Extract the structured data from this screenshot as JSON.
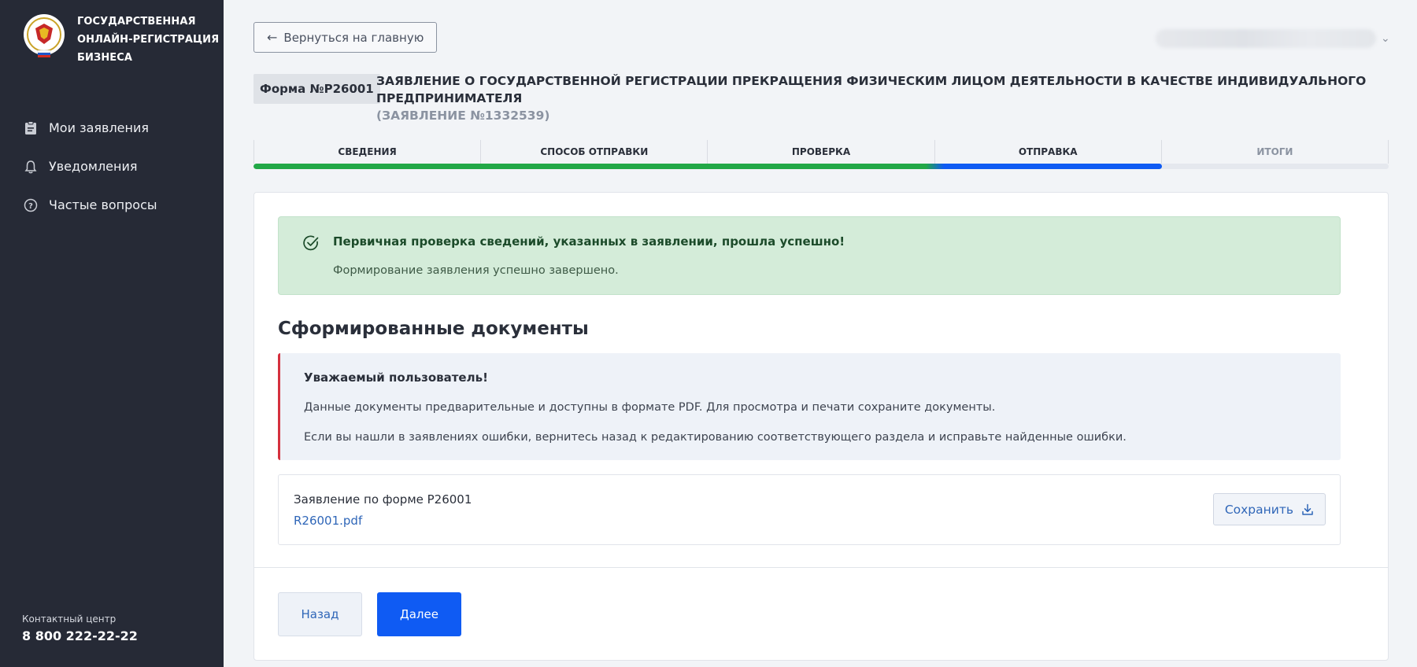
{
  "sidebar": {
    "brand": {
      "line1": "ГОСУДАРСТВЕННАЯ",
      "line2": "ОНЛАЙН-РЕГИСТРАЦИЯ",
      "line3": "БИЗНЕСА"
    },
    "nav": [
      {
        "label": "Мои заявления",
        "icon": "clipboard-icon"
      },
      {
        "label": "Уведомления",
        "icon": "bell-icon"
      },
      {
        "label": "Частые вопросы",
        "icon": "question-icon"
      }
    ],
    "contact": {
      "label": "Контактный центр",
      "phone": "8 800 222-22-22"
    }
  },
  "header": {
    "back_label": "Вернуться на главную",
    "form_badge": "Форма №Р26001",
    "title": "ЗАЯВЛЕНИЕ О ГОСУДАРСТВЕННОЙ РЕГИСТРАЦИИ ПРЕКРАЩЕНИЯ ФИЗИЧЕСКИМ ЛИЦОМ ДЕЯТЕЛЬНОСТИ В КАЧЕСТВЕ ИНДИВИДУАЛЬНОГО ПРЕДПРИНИМАТЕЛЯ",
    "subtitle": "(ЗАЯВЛЕНИЕ №1332539)"
  },
  "steps": {
    "items": [
      {
        "label": "СВЕДЕНИЯ",
        "state": "done"
      },
      {
        "label": "СПОСОБ ОТПРАВКИ",
        "state": "done"
      },
      {
        "label": "ПРОВЕРКА",
        "state": "done"
      },
      {
        "label": "ОТПРАВКА",
        "state": "current"
      },
      {
        "label": "ИТОГИ",
        "state": "pending"
      }
    ],
    "progress_fraction": 0.8,
    "colors": {
      "done": "#22a847",
      "current": "#0f5bf3",
      "track": "#e5e8ee"
    }
  },
  "success": {
    "title": "Первичная проверка сведений, указанных в заявлении, прошла успешно!",
    "text": "Формирование заявления успешно завершено."
  },
  "documents": {
    "title": "Сформированные документы",
    "notice": {
      "title": "Уважаемый пользователь!",
      "line1": "Данные документы предварительные и доступны в формате PDF. Для просмотра и печати сохраните документы.",
      "line2": "Если вы нашли в заявлениях ошибки, вернитесь назад к редактированию соответствующего раздела и исправьте найденные ошибки."
    },
    "items": [
      {
        "name": "Заявление по форме Р26001",
        "file": "R26001.pdf",
        "save_label": "Сохранить"
      }
    ]
  },
  "actions": {
    "back_label": "Назад",
    "next_label": "Далее"
  }
}
